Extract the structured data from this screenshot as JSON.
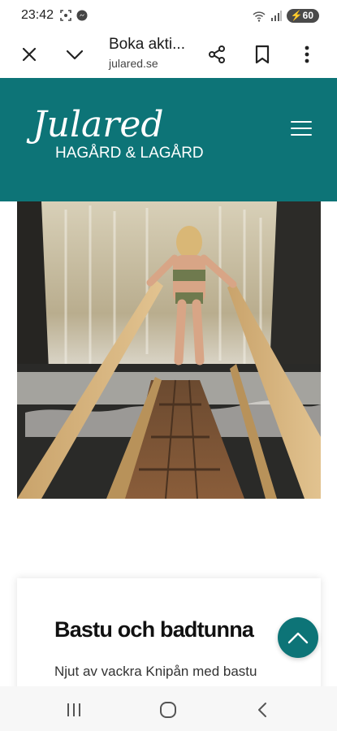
{
  "status_bar": {
    "time": "23:42",
    "battery": "60"
  },
  "browser": {
    "page_title": "Boka akti...",
    "domain": "julared.se"
  },
  "site": {
    "logo_main": "Julared",
    "logo_sub": "HAGÅRD & LAGÅRD",
    "brand_color": "#0d7477"
  },
  "card": {
    "title": "Bastu och badtunna",
    "text": "Njut av vackra Knipån med bastu"
  },
  "icons": {
    "close": "close-icon",
    "collapse": "chevron-down-icon",
    "share": "share-icon",
    "bookmark": "bookmark-icon",
    "more": "more-vert-icon",
    "menu": "hamburger-icon",
    "back_to_top": "chevron-up-icon"
  }
}
